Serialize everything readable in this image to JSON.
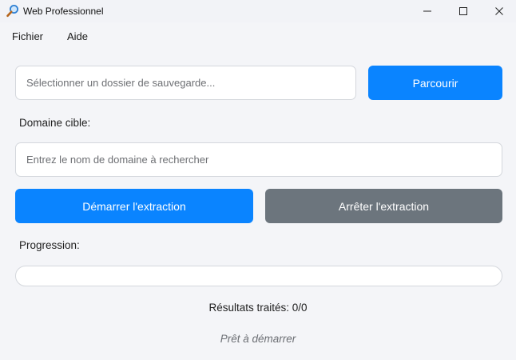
{
  "window": {
    "title": "Web Professionnel",
    "icon": "magnifier-icon"
  },
  "menu": {
    "items": [
      "Fichier",
      "Aide"
    ]
  },
  "folder": {
    "placeholder": "Sélectionner un dossier de sauvegarde...",
    "value": "",
    "browse_label": "Parcourir"
  },
  "domain": {
    "label": "Domaine cible:",
    "placeholder": "Entrez le nom de domaine à rechercher",
    "value": ""
  },
  "actions": {
    "start_label": "Démarrer l'extraction",
    "stop_label": "Arrêter l'extraction"
  },
  "progress": {
    "label": "Progression:",
    "value": 0
  },
  "results": {
    "text": "Résultats traités: 0/0"
  },
  "status": {
    "text": "Prêt à démarrer"
  },
  "colors": {
    "primary": "#0a84ff",
    "secondary": "#6c757d",
    "background": "#f4f5f8"
  }
}
